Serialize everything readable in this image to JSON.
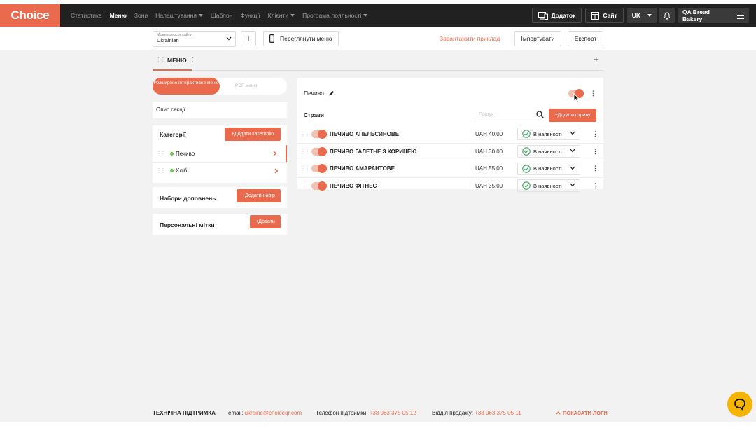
{
  "topbar": {
    "logo": "Choice",
    "nav": [
      {
        "label": "Статистика",
        "active": false,
        "dropdown": false
      },
      {
        "label": "Меню",
        "active": true,
        "dropdown": false
      },
      {
        "label": "Зони",
        "active": false,
        "dropdown": false
      },
      {
        "label": "Налаштування",
        "active": false,
        "dropdown": true
      },
      {
        "label": "Шаблон",
        "active": false,
        "dropdown": false
      },
      {
        "label": "Функції",
        "active": false,
        "dropdown": false
      },
      {
        "label": "Клієнти",
        "active": false,
        "dropdown": true
      },
      {
        "label": "Програма лояльності",
        "active": false,
        "dropdown": true
      }
    ],
    "app_label": "Додаток",
    "site_label": "Сайт",
    "lang": "UK",
    "account": "QA Bread Bakery"
  },
  "subbar": {
    "lang_select_label": "Мовна версія сайту:",
    "lang_select_value": "Ukrainian",
    "preview_label": "Переглянути меню",
    "download_example": "Завантажити приклад",
    "import_label": "Імпортувати",
    "export_label": "Експорт"
  },
  "tabs": {
    "menu_tab": "МЕНЮ"
  },
  "left": {
    "seg_active": "Розширене інтерактивне меню",
    "seg_inactive": "PDF меню",
    "section_desc": "Опис секції",
    "categories_title": "Категорії",
    "add_category": "+Додати категорію",
    "categories": [
      {
        "label": "Печиво",
        "selected": true
      },
      {
        "label": "Хліб",
        "selected": false
      }
    ],
    "addon_sets_title": "Набори доповнень",
    "add_set": "+Додати набір",
    "tags_title": "Персональні мітки",
    "add_tag": "+Додати"
  },
  "main": {
    "category_title": "Печиво",
    "dishes_label": "Страви",
    "search_placeholder": "Пошук",
    "add_dish": "+Додати страву",
    "dishes": [
      {
        "name": "ПЕЧИВО АПЕЛЬСИНОВЕ",
        "price": "UAH 40.00",
        "status": "В наявності"
      },
      {
        "name": "ПЕЧИВО ГАЛЕТНЕ З КОРИЦЕЮ",
        "price": "UAH 30.00",
        "status": "В наявності"
      },
      {
        "name": "ПЕЧИВО АМАРАНТОВЕ",
        "price": "UAH 55.00",
        "status": "В наявності"
      },
      {
        "name": "ПЕЧИВО ФІТНЕС",
        "price": "UAH 35.00",
        "status": "В наявності"
      }
    ]
  },
  "footer": {
    "support_title": "ТЕХНІЧНА ПІДТРИМКА",
    "email_label": "email:",
    "email": "ukraine@choiceqr.com",
    "phone_label": "Телефон підтримки:",
    "phone": "+38 063 375 05 12",
    "sales_label": "Відділ продажу:",
    "sales_phone": "+38 063 375 05 11",
    "show_logs": "ПОКАЗАТИ ЛОГИ"
  },
  "colors": {
    "accent": "#ea6a4e",
    "topbar": "#212121",
    "background": "#f2f2f2",
    "chat": "#f5b400"
  }
}
